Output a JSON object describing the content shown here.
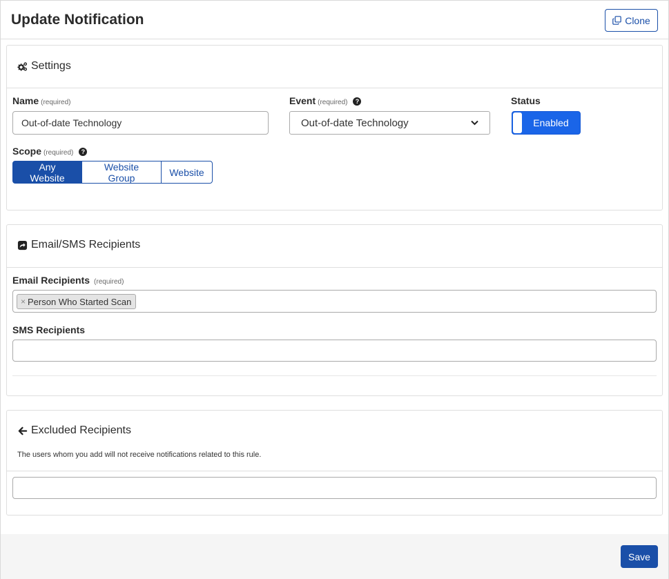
{
  "header": {
    "title": "Update Notification",
    "clone_label": "Clone"
  },
  "settings": {
    "title": "Settings",
    "name_label": "Name",
    "name_required": "(required)",
    "name_value": "Out-of-date Technology",
    "event_label": "Event",
    "event_required": "(required)",
    "event_value": "Out-of-date Technology",
    "status_label": "Status",
    "status_value": "Enabled",
    "scope_label": "Scope",
    "scope_required": "(required)",
    "scope_options": [
      "Any Website",
      "Website Group",
      "Website"
    ],
    "scope_selected": "Any Website"
  },
  "recipients": {
    "title": "Email/SMS Recipients",
    "email_label": "Email Recipients",
    "email_required": "(required)",
    "email_tags": [
      "Person Who Started Scan"
    ],
    "tag_remove": "×",
    "sms_label": "SMS Recipients"
  },
  "excluded": {
    "title": "Excluded Recipients",
    "description": "The users whom you add will not receive notifications related to this rule."
  },
  "footer": {
    "save_label": "Save"
  },
  "colors": {
    "primary": "#1a4fa8",
    "toggle": "#1a65e8",
    "footer_bg": "#f5f5f5"
  },
  "icons": {
    "clone": "clone-icon",
    "settings": "cogs-icon",
    "recipients": "share-square-icon",
    "excluded": "arrow-left-icon",
    "help": "question-circle-icon",
    "dropdown": "chevron-down-icon"
  }
}
